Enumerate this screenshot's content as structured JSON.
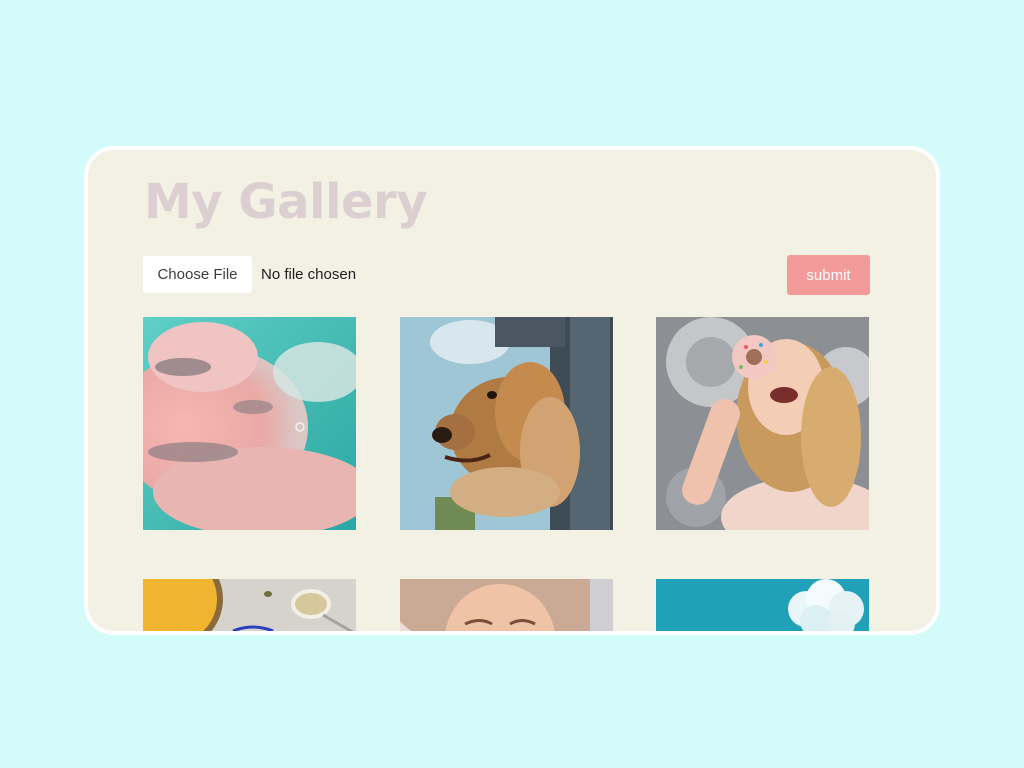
{
  "gallery": {
    "title": "My Gallery",
    "upload": {
      "choose_label": "Choose File",
      "status": "No file chosen",
      "submit_label": "submit"
    },
    "images": [
      {
        "name": "pink-clouds-sky"
      },
      {
        "name": "dog-window"
      },
      {
        "name": "woman-donut"
      },
      {
        "name": "soup-and-spoon"
      },
      {
        "name": "smiling-woman-hat"
      },
      {
        "name": "blue-sky-cloud"
      }
    ]
  },
  "colors": {
    "page_background": "#d2fbf9",
    "card_background": "#f3f1e3",
    "title": "#dccfd2",
    "submit_button": "#f39a9a"
  }
}
